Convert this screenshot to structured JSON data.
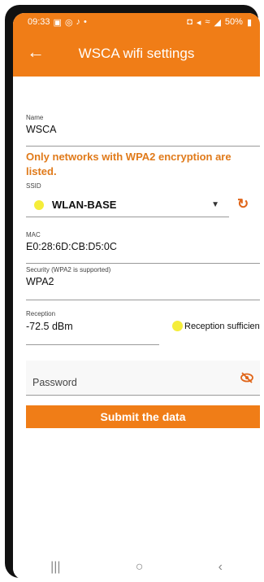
{
  "status_bar": {
    "time": "09:33",
    "left_icons": [
      "message-icon",
      "whatsapp-icon",
      "sound-icon",
      "dot-icon"
    ],
    "right_icons": [
      "alarm-icon",
      "mute-icon",
      "wifi-icon",
      "signal-icon"
    ],
    "battery": "50%"
  },
  "app_bar": {
    "back_icon": "back-arrow-icon",
    "title": "WSCA wifi settings"
  },
  "form": {
    "name": {
      "label": "Name",
      "value": "WSCA"
    },
    "notice": "Only networks with WPA2 encryption are listed.",
    "ssid": {
      "label": "SSID",
      "value": "WLAN-BASE",
      "indicator_color": "#f5ed3a"
    },
    "refresh_icon": "refresh-icon",
    "mac": {
      "label": "MAC",
      "value": "E0:28:6D:CB:D5:0C"
    },
    "security": {
      "label": "Security (WPA2 is supported)",
      "value": "WPA2"
    },
    "reception": {
      "label": "Reception",
      "value": "-72.5 dBm",
      "status": "Reception sufficient",
      "status_color": "#f5ed3a"
    },
    "password": {
      "placeholder": "Password",
      "visibility_icon": "eye-off-icon"
    },
    "submit_label": "Submit the data"
  },
  "nav_bar": {
    "recents": "|||",
    "home": "○",
    "back": "‹"
  },
  "colors": {
    "accent": "#f07d17",
    "notice": "#e07a1a"
  }
}
